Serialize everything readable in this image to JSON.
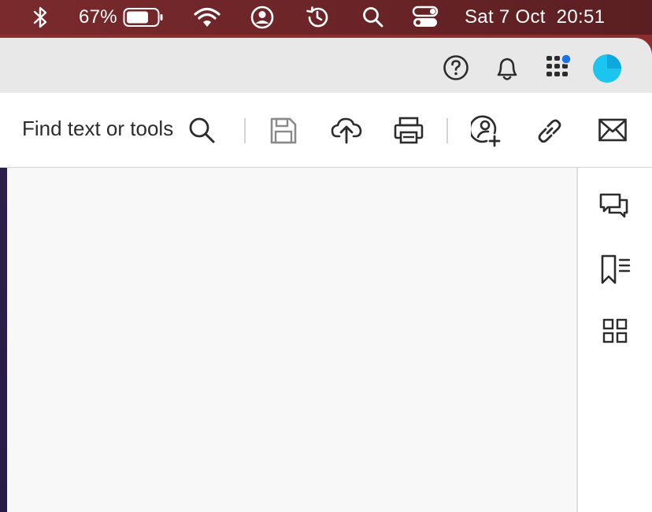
{
  "menubar": {
    "battery_percent": "67%",
    "datetime": "Sat 7 Oct  20:51",
    "icons": [
      "bluetooth-icon",
      "battery-icon",
      "wifi-icon",
      "user-account-icon",
      "time-machine-icon",
      "spotlight-search-icon",
      "control-center-icon"
    ]
  },
  "app_header": {
    "icons": [
      "help-icon",
      "notifications-bell-icon",
      "apps-grid-icon",
      "profile-avatar-icon"
    ],
    "apps_badge_color": "#1a73e8",
    "avatar_color": "#1cc4f0"
  },
  "toolbar": {
    "find_label": "Find text or tools",
    "icons": [
      "search-icon",
      "save-icon",
      "cloud-upload-icon",
      "print-icon",
      "share-with-people-icon",
      "copy-link-icon",
      "email-icon"
    ]
  },
  "right_panel": {
    "icons": [
      "comments-icon",
      "bookmarks-icon",
      "thumbnails-grid-icon"
    ]
  },
  "colors": {
    "menubar_bg": "#6d2528",
    "icon_color": "#2c2c2c",
    "disabled_icon": "#8a8a8a"
  }
}
